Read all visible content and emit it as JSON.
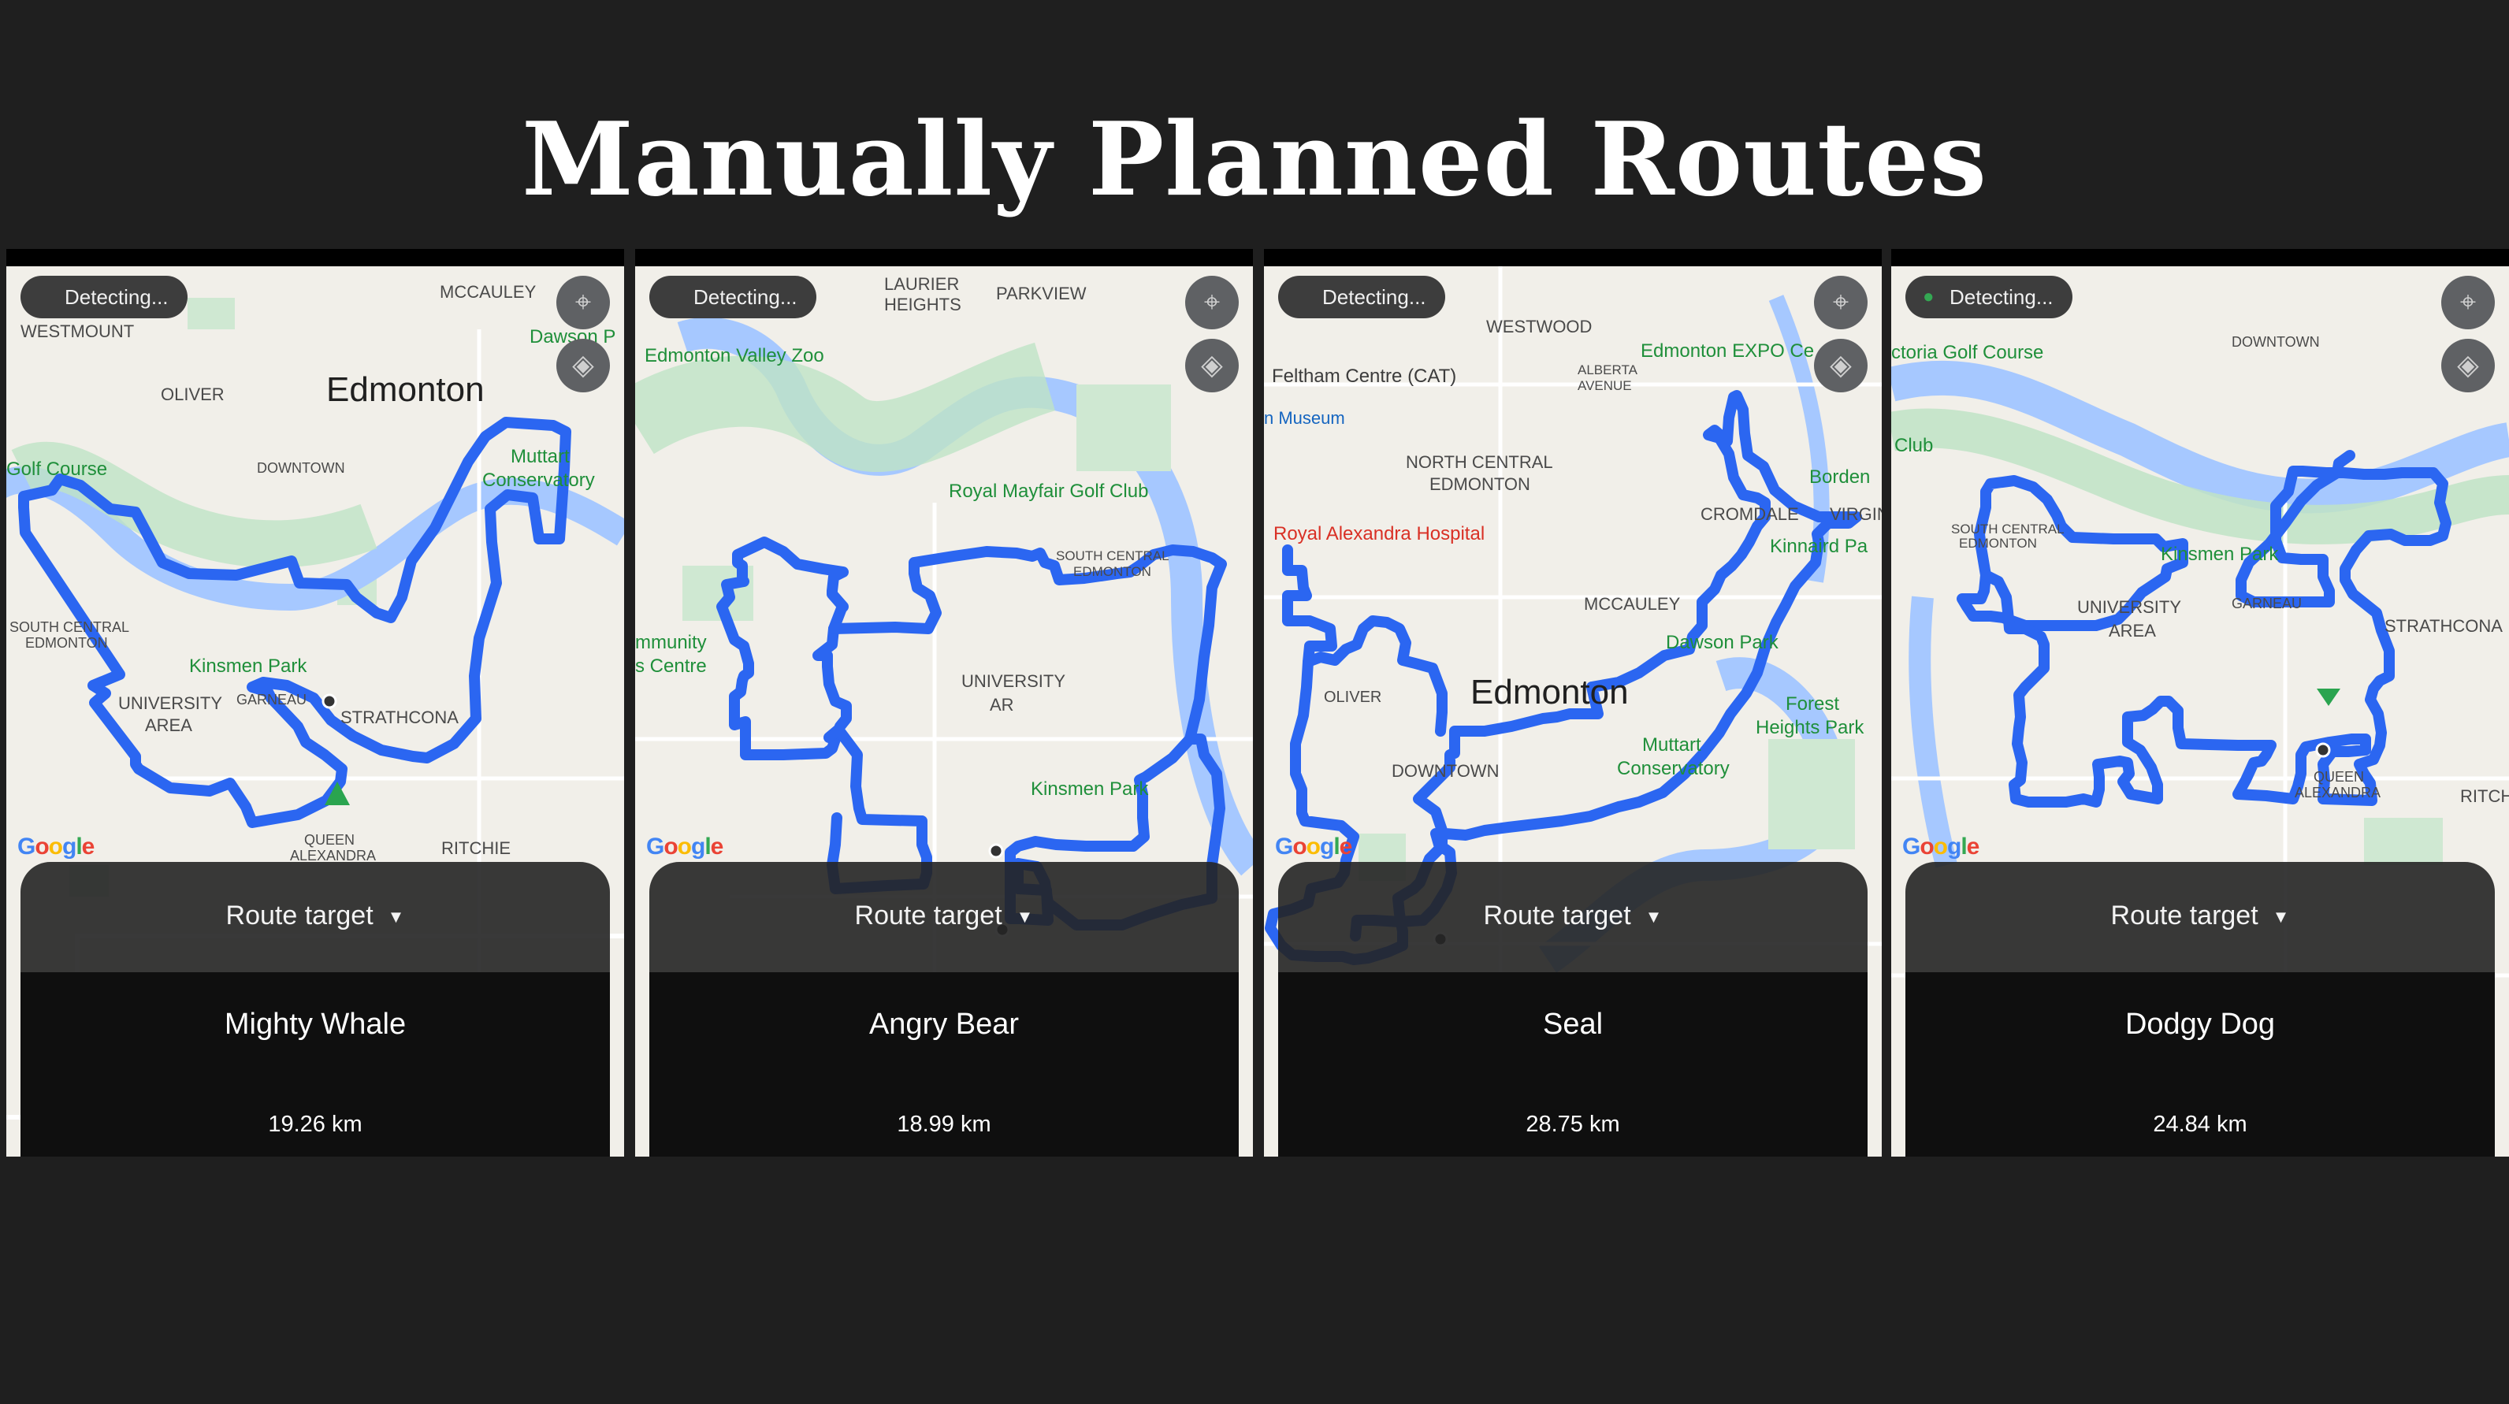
{
  "title": "Manually Planned Routes",
  "common": {
    "detecting_label": "Detecting...",
    "route_target_label": "Route target",
    "caret_icon": "▼",
    "google_logo": "Google",
    "locate_icon": "⌖",
    "layers_icon": "◈",
    "route_color": "#2b66f1"
  },
  "phones": [
    {
      "route_name": "Mighty Whale",
      "distance": "19.26 km",
      "labels": {
        "l1": "MCCAULEY",
        "l2": "WESTMOUNT",
        "l3": "Dawson P",
        "l4": "OLIVER",
        "l5": "Edmonton",
        "l6": "Golf Course",
        "l7": "DOWNTOWN",
        "l8": "Muttart",
        "l9": "Conservatory",
        "l10": "SOUTH CENTRAL",
        "l11": "EDMONTON",
        "l12": "Kinsmen Park",
        "l13": "UNIVERSITY",
        "l14": "AREA",
        "l15": "GARNEAU",
        "l16": "STRATHCONA",
        "l17": "QUEEN",
        "l18": "ALEXANDRA",
        "l19": "RITCHIE"
      }
    },
    {
      "route_name": "Angry Bear",
      "distance": "18.99 km",
      "labels": {
        "l1": "LAURIER",
        "l2": "HEIGHTS",
        "l3": "PARKVIEW",
        "l4": "Edmonton Valley Zoo",
        "l5": "Royal Mayfair Golf Club",
        "l6": "SOUTH CENTRAL",
        "l7": "EDMONTON",
        "l8": "mmunity",
        "l9": "s Centre",
        "l10": "UNIVERSITY",
        "l11": "AR",
        "l12": "Kinsmen Park"
      }
    },
    {
      "route_name": "Seal",
      "distance": "28.75 km",
      "labels": {
        "l1": "WESTWOOD",
        "l2": "Edmonton EXPO Ce",
        "l3": "Feltham Centre (CAT)",
        "l4": "ALBERTA",
        "l5": "AVENUE",
        "l6": "n Museum",
        "l7": "NORTH CENTRAL",
        "l8": "EDMONTON",
        "l9": "Borden",
        "l10": "CROMDALE",
        "l11": "VIRGINI",
        "l12": "Royal Alexandra Hospital",
        "l13": "Kinnaird Pa",
        "l14": "MCCAULEY",
        "l15": "Dawson Park",
        "l16": "OLIVER",
        "l17": "Edmonton",
        "l18": "Forest",
        "l19": "Heights Park",
        "l20": "DOWNTOWN",
        "l21": "Muttart",
        "l22": "Conservatory"
      }
    },
    {
      "route_name": "Dodgy Dog",
      "distance": "24.84 km",
      "labels": {
        "l1": "ctoria Golf Course",
        "l2": "DOWNTOWN",
        "l3": "Club",
        "l4": "SOUTH CENTRAL",
        "l5": "EDMONTON",
        "l6": "Kinsmen Park",
        "l7": "UNIVERSITY",
        "l8": "AREA",
        "l9": "GARNEAU",
        "l10": "STRATHCONA",
        "l11": "QUEEN",
        "l12": "ALEXANDRA",
        "l13": "RITCH"
      }
    }
  ]
}
